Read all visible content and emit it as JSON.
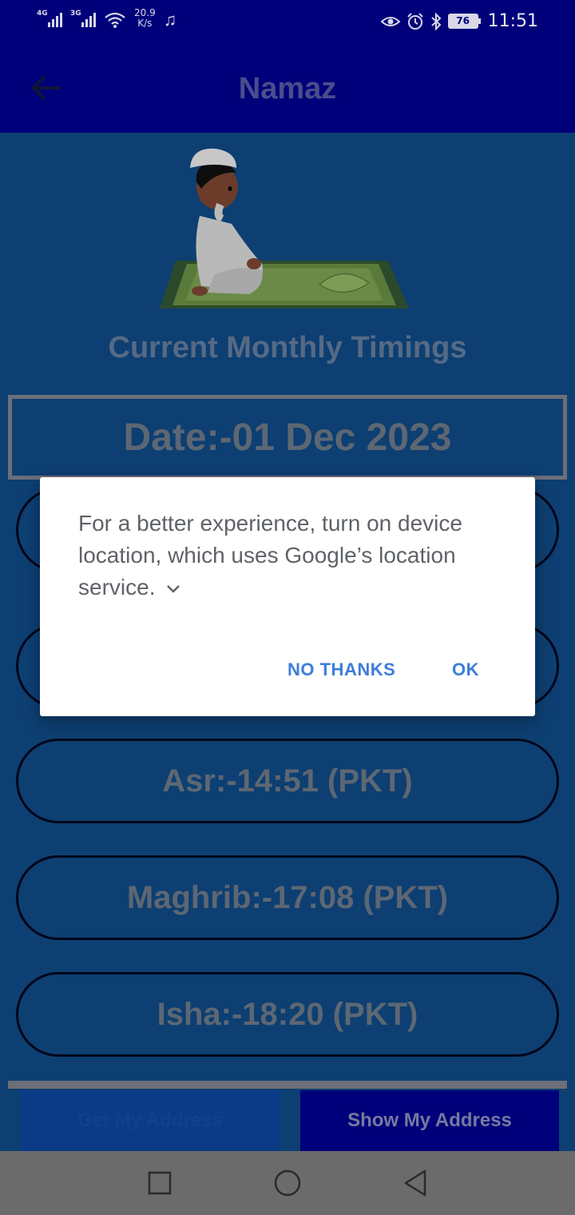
{
  "status_bar": {
    "signal_1_label": "4G",
    "signal_2_label": "3G",
    "net_speed_value": "20.9",
    "net_speed_unit": "K/s",
    "battery": "76",
    "time": "11:51",
    "icons": [
      "signal-icon",
      "wifi-icon",
      "music-icon",
      "eye-icon",
      "alarm-icon",
      "bluetooth-icon",
      "battery-icon"
    ]
  },
  "app_bar": {
    "title": "Namaz",
    "back_icon": "arrow-left-icon"
  },
  "main": {
    "heading": "Current Monthly Timings",
    "date": "Date:-01 Dec 2023",
    "timings": [
      {
        "label": "Asr:-14:51 (PKT)"
      },
      {
        "label": "Maghrib:-17:08 (PKT)"
      },
      {
        "label": "Isha:-18:20 (PKT)"
      }
    ],
    "get_address_label": "Get My Address",
    "show_address_label": "Show My Address"
  },
  "dialog": {
    "message": "For a better experience, turn on device location, which uses Google’s location service.",
    "no_thanks_label": "NO THANKS",
    "ok_label": "OK"
  },
  "nav_bar": {
    "icons": [
      "recents-icon",
      "home-icon",
      "back-icon"
    ]
  },
  "colors": {
    "app_bar": "#00007a",
    "background": "#0d3f72",
    "dialog_button": "#3c7dd9",
    "nav_bar": "#6b6b6b"
  }
}
